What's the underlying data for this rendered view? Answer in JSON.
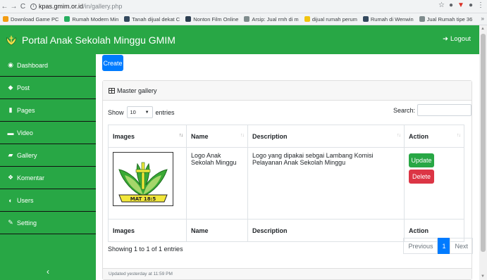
{
  "browser": {
    "url_host": "kpas.gmim.or.id",
    "url_path": "/in/gallery.php",
    "bookmarks": [
      {
        "label": "Download Game PC",
        "color": "#f39c12"
      },
      {
        "label": "Rumah Modern Min",
        "color": "#27ae60"
      },
      {
        "label": "Tanah dijual dekat C",
        "color": "#34495e"
      },
      {
        "label": "Nonton Film Online",
        "color": "#2c3e50"
      },
      {
        "label": "Arsip: Jual rmh di m",
        "color": "#7f8c8d"
      },
      {
        "label": "dijual rumah perum",
        "color": "#f1c40f"
      },
      {
        "label": "Rumah di Wenwin",
        "color": "#34495e"
      },
      {
        "label": "Jual Rumah tipe 36",
        "color": "#7f8c8d"
      }
    ],
    "more": "»"
  },
  "app": {
    "brand": "Portal Anak Sekolah Minggu GMIM",
    "logout": "Logout",
    "accent": "#28a745"
  },
  "sidebar": {
    "items": [
      {
        "label": "Dashboard",
        "icon": "dashboard-icon",
        "glyph": "◉"
      },
      {
        "label": "Post",
        "icon": "tag-icon",
        "glyph": "◆"
      },
      {
        "label": "Pages",
        "icon": "file-icon",
        "glyph": "▮"
      },
      {
        "label": "Video",
        "icon": "video-icon",
        "glyph": "▬"
      },
      {
        "label": "Gallery",
        "icon": "book-icon",
        "glyph": "▰"
      },
      {
        "label": "Komentar",
        "icon": "users-icon",
        "glyph": "❖"
      },
      {
        "label": "Users",
        "icon": "user-circle-icon",
        "glyph": "◐"
      },
      {
        "label": "Setting",
        "icon": "wrench-icon",
        "glyph": "✎"
      }
    ],
    "collapse": "‹"
  },
  "main": {
    "create_label": "Create",
    "card_title": "Master gallery",
    "show_label": "Show",
    "entries_value": "10",
    "entries_label": "entries",
    "search_label": "Search:",
    "columns": [
      "Images",
      "Name",
      "Description",
      "Action"
    ],
    "rows": [
      {
        "name": "Logo Anak Sekolah Minggu",
        "description": "Logo yang dipakai sebgai Lambang Komisi Pelayanan Anak Sekolah Minggu",
        "logo_text": "MAT 18:5"
      }
    ],
    "update_label": "Update",
    "delete_label": "Delete",
    "info": "Showing 1 to 1 of 1 entries",
    "pager": {
      "previous": "Previous",
      "page": "1",
      "next": "Next"
    },
    "footer": "Updated yesterday at 11:59 PM"
  }
}
